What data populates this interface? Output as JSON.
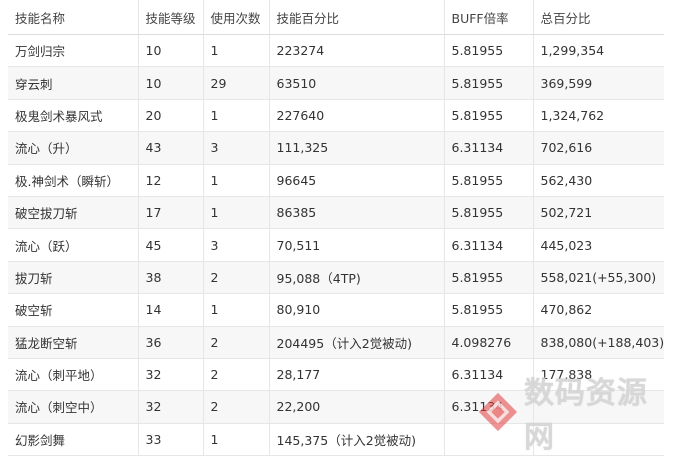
{
  "table": {
    "headers": [
      "技能名称",
      "技能等级",
      "使用次数",
      "技能百分比",
      "BUFF倍率",
      "总百分比"
    ],
    "rows": [
      [
        "万剑归宗",
        "10",
        "1",
        "223274",
        "5.81955",
        "1,299,354"
      ],
      [
        "穿云刺",
        "10",
        "29",
        "63510",
        "5.81955",
        "369,599"
      ],
      [
        "极鬼剑术暴风式",
        "20",
        "1",
        "227640",
        "5.81955",
        "1,324,762"
      ],
      [
        "流心（升）",
        "43",
        "3",
        "111,325",
        "6.31134",
        "702,616"
      ],
      [
        "极.神剑术（瞬斩）",
        "12",
        "1",
        "96645",
        "5.81955",
        "562,430"
      ],
      [
        "破空拔刀斩",
        "17",
        "1",
        "86385",
        "5.81955",
        "502,721"
      ],
      [
        "流心（跃）",
        "45",
        "3",
        "70,511",
        "6.31134",
        "445,023"
      ],
      [
        "拔刀斩",
        "38",
        "2",
        "95,088（4TP)",
        "5.81955",
        "558,021(+55,300)"
      ],
      [
        "破空斩",
        "14",
        "1",
        "80,910",
        "5.81955",
        "470,862"
      ],
      [
        "猛龙断空斩",
        "36",
        "2",
        "204495（计入2觉被动)",
        "4.098276",
        "838,080(+188,403)"
      ],
      [
        "流心（刺平地）",
        "32",
        "2",
        "28,177",
        "6.31134",
        "177,838"
      ],
      [
        "流心（刺空中）",
        "32",
        "2",
        "22,200",
        "6.31134",
        ""
      ],
      [
        "幻影剑舞",
        "33",
        "1",
        "145,375（计入2觉被动)",
        "",
        ""
      ]
    ]
  },
  "watermark": {
    "text": "数码资源网",
    "icon": "red-diamond-logo-icon"
  }
}
